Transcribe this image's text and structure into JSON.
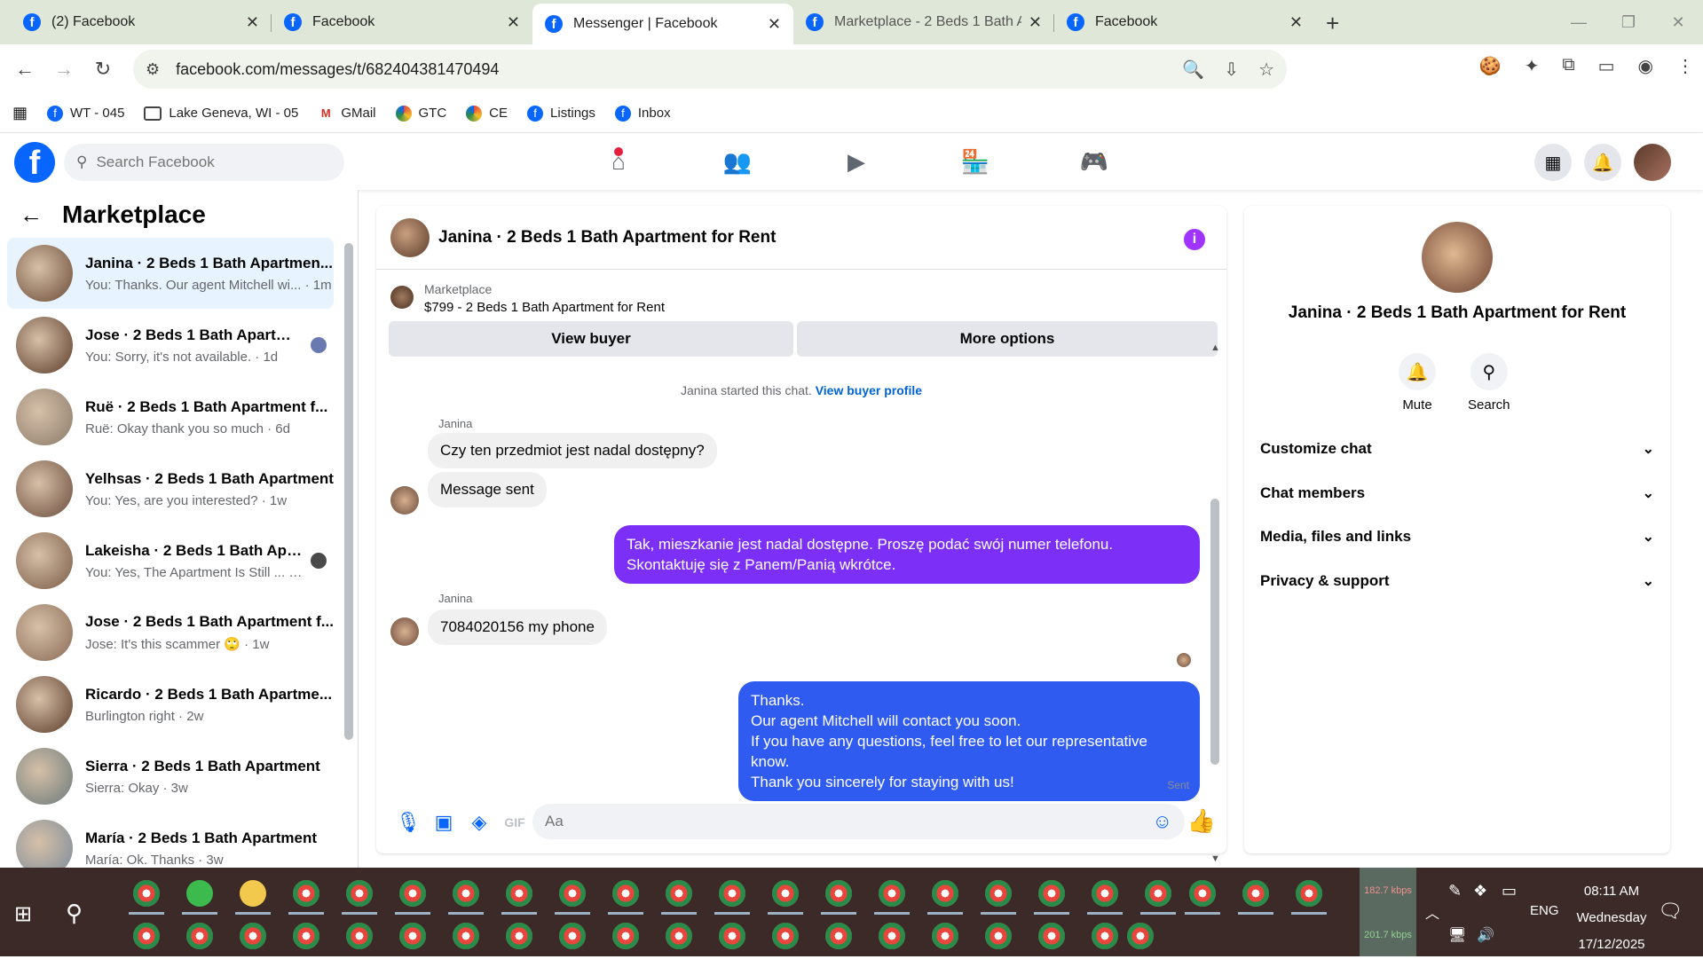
{
  "browser": {
    "tabs": [
      {
        "title": "(2) Facebook",
        "active": false
      },
      {
        "title": "Facebook",
        "active": false
      },
      {
        "title": "Messenger | Facebook",
        "active": true
      },
      {
        "title": "Marketplace - 2 Beds 1 Bath Ap",
        "active": false
      },
      {
        "title": "Facebook",
        "active": false
      }
    ],
    "url": "facebook.com/messages/t/682404381470494",
    "bookmarks": [
      {
        "label": "WT - 045",
        "icon": "facebook-icon"
      },
      {
        "label": "Lake Geneva, WI - 05",
        "icon": "folder-icon"
      },
      {
        "label": "GMail",
        "icon": "gmail-icon"
      },
      {
        "label": "GTC",
        "icon": "rainbow-icon"
      },
      {
        "label": "CE",
        "icon": "rainbow-icon"
      },
      {
        "label": "Listings",
        "icon": "facebook-icon"
      },
      {
        "label": "Inbox",
        "icon": "facebook-icon"
      }
    ]
  },
  "facebook": {
    "search_placeholder": "Search Facebook",
    "accent": "#0866ff"
  },
  "sidebar": {
    "title": "Marketplace",
    "conversations": [
      {
        "name": "Janina · 2 Beds 1 Bath Apartmen...",
        "preview": "You: Thanks. Our agent Mitchell wi... · 1m",
        "selected": true,
        "thumb": "#6b4a35"
      },
      {
        "name": "Jose · 2 Beds 1 Bath Apartme...",
        "preview": "You: Sorry, it's not available. · 1d",
        "selected": false,
        "thumb": "#5b3a28"
      },
      {
        "name": "Ruë · 2 Beds 1 Bath Apartment f...",
        "preview": "Ruë: Okay thank you so much · 6d",
        "selected": false,
        "thumb": "#8a7a6a"
      },
      {
        "name": "Yelhsas · 2 Beds 1 Bath Apartment",
        "preview": "You: Yes, are you interested? · 1w",
        "selected": false,
        "thumb": "#6a4a3a"
      },
      {
        "name": "Lakeisha · 2 Beds 1 Bath Apart...",
        "preview": "You: Yes, The Apartment Is Still ... · 1w",
        "selected": false,
        "thumb": "#7a5a45"
      },
      {
        "name": "Jose · 2 Beds 1 Bath Apartment f...",
        "preview": "Jose: It's this scammer 🙄 · 1w",
        "selected": false,
        "thumb": "#8a6a55"
      },
      {
        "name": "Ricardo · 2 Beds 1 Bath Apartme...",
        "preview": "Burlington right · 2w",
        "selected": false,
        "thumb": "#5a3a28"
      },
      {
        "name": "Sierra · 2 Beds 1 Bath Apartment",
        "preview": "Sierra: Okay · 3w",
        "selected": false,
        "thumb": "#6a7a7a"
      },
      {
        "name": "María · 2 Beds 1 Bath Apartment",
        "preview": "María: Ok. Thanks · 3w",
        "selected": false,
        "thumb": "#7a8a9a"
      }
    ]
  },
  "chat": {
    "title": "Janina · 2 Beds 1 Bath Apartment for Rent",
    "marketplace_label": "Marketplace",
    "listing": "$799 - 2 Beds 1 Bath Apartment for Rent",
    "view_buyer": "View buyer",
    "more_options": "More options",
    "system_text": "Janina started this chat.",
    "system_link": "View buyer profile",
    "sender_name": "Janina",
    "msg1": "Czy ten przedmiot jest nadal dostępny?",
    "msg2": "Message sent",
    "msg3": "Tak, mieszkanie jest nadal dostępne. Proszę podać swój numer telefonu. Skontaktuję się z Panem/Panią wkrótce.",
    "msg4": "7084020156 my phone",
    "msg5_l1": "Thanks.",
    "msg5_l2": "Our agent Mitchell will contact you soon.",
    "msg5_l3": "If you have any questions, feel free to let our representative know.",
    "msg5_l4": "Thank you sincerely for staying with us!",
    "sent_label": "Sent",
    "composer_placeholder": "Aa",
    "colors": {
      "out_purple": "#7b2ff7",
      "out_blue": "#2f5bf0",
      "in_bg": "#f0f0f0"
    }
  },
  "details": {
    "title": "Janina · 2 Beds 1 Bath Apartment for Rent",
    "mute": "Mute",
    "search": "Search",
    "rows": [
      "Customize chat",
      "Chat members",
      "Media, files and links",
      "Privacy & support"
    ]
  },
  "taskbar": {
    "speed_up": "182.7 kbps",
    "speed_down": "201.7 kbps",
    "lang": "ENG",
    "time": "08:11 AM",
    "day": "Wednesday",
    "date": "17/12/2025"
  }
}
